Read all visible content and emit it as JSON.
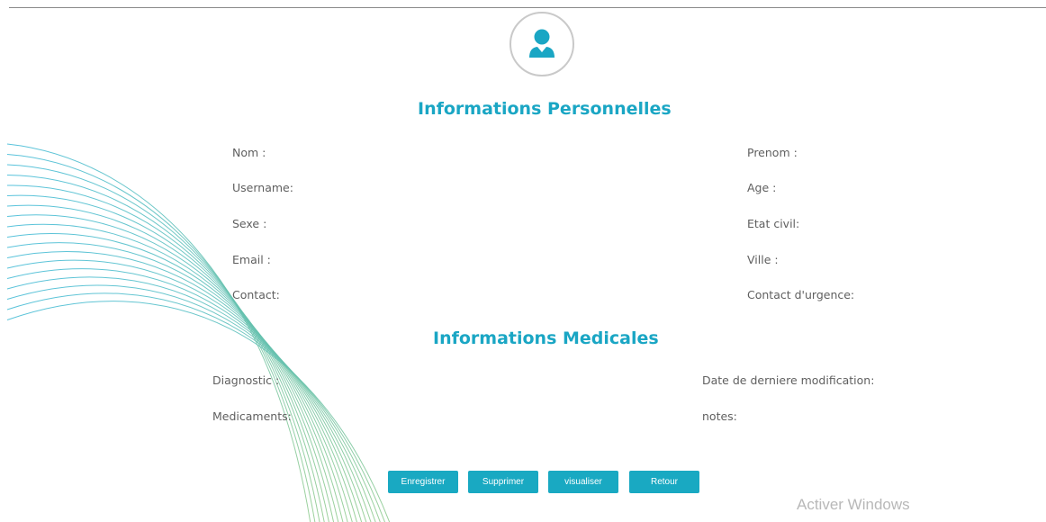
{
  "header": {
    "avatar_icon": "user-icon"
  },
  "sections": {
    "personal_title": "Informations Personnelles",
    "medical_title": "Informations Medicales"
  },
  "personal": {
    "nom": "Nom :",
    "prenom": "Prenom :",
    "username": "Username:",
    "age": "Age :",
    "sexe": "Sexe :",
    "etat_civil": "Etat civil:",
    "email": "Email :",
    "ville": "Ville :",
    "contact": "Contact:",
    "contact_urgence": "Contact d'urgence:"
  },
  "medical": {
    "diagnostic": "Diagnostic :",
    "date_modification": "Date de derniere modification:",
    "medicaments": "Medicaments:",
    "notes": "notes:"
  },
  "buttons": {
    "enregistrer": "Enregistrer",
    "supprimer": "Supprimer",
    "visualiser": "visualiser",
    "retour": "Retour"
  },
  "watermark": {
    "text": "Activer Windows"
  },
  "colors": {
    "accent": "#1aa6c4",
    "button": "#19a9c2",
    "wave_start": "#3bb8d6",
    "wave_end": "#8cc98a"
  }
}
